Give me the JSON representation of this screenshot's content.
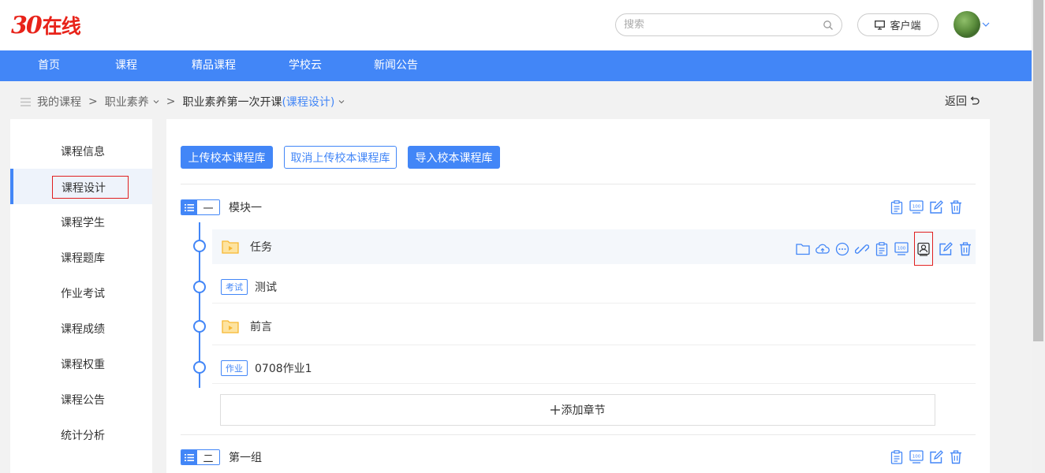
{
  "header": {
    "logo_number": "30",
    "logo_text": "在线",
    "search_placeholder": "搜索",
    "client_label": "客户端"
  },
  "nav": {
    "items": [
      "首页",
      "课程",
      "精品课程",
      "学校云",
      "新闻公告"
    ]
  },
  "breadcrumb": {
    "root": "我的课程",
    "course": "职业素养",
    "current": "职业素养第一次开课",
    "current_section": "(课程设计)",
    "separator": ">"
  },
  "back_label": "返回",
  "sidebar": {
    "items": [
      "课程信息",
      "课程设计",
      "课程学生",
      "课程题库",
      "作业考试",
      "课程成绩",
      "课程权重",
      "课程公告",
      "统计分析"
    ],
    "active": "课程设计"
  },
  "toolbar": {
    "upload_label": "上传校本课程库",
    "cancel_upload_label": "取消上传校本课程库",
    "import_label": "导入校本课程库"
  },
  "chapters": [
    {
      "number": "一",
      "title": "模块一",
      "items": [
        {
          "type": "folder",
          "title": "任务"
        },
        {
          "type": "exam",
          "badge": "考试",
          "title": "测试"
        },
        {
          "type": "folder",
          "title": "前言"
        },
        {
          "type": "homework",
          "badge": "作业",
          "title": "0708作业1"
        }
      ],
      "add_section_label": "添加章节"
    },
    {
      "number": "二",
      "title": "第一组"
    }
  ],
  "colors": {
    "accent": "#4286f7",
    "folder": "#f7b731",
    "highlight_border": "#e02020"
  }
}
